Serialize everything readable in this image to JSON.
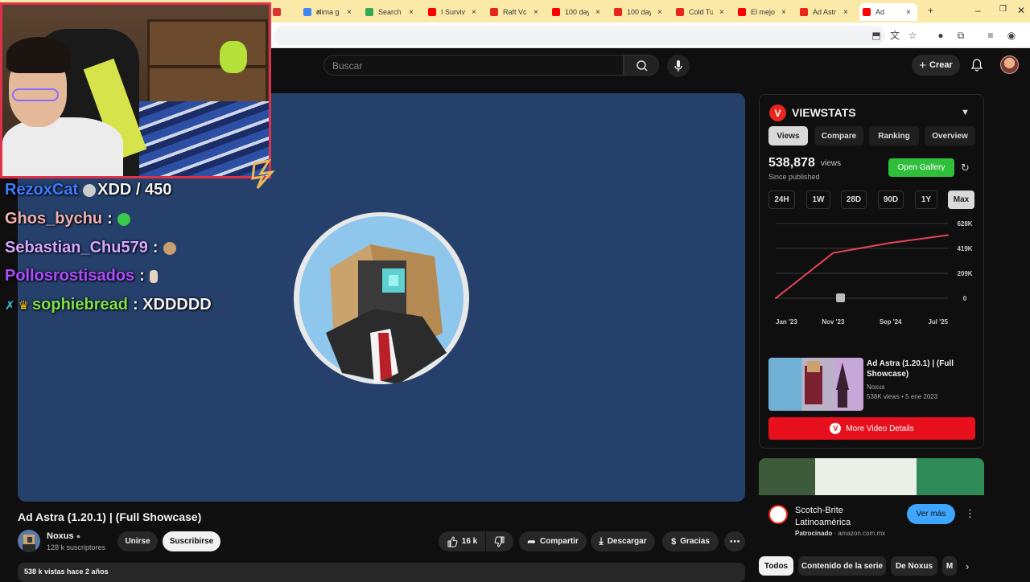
{
  "browser": {
    "tabs": [
      {
        "label": "",
        "icon": "unknown-favicon",
        "color": "#d33"
      },
      {
        "label": "clima g",
        "icon": "google-icon",
        "color": "#4285f4"
      },
      {
        "label": "Search",
        "icon": "search-extension-icon",
        "color": "#34a853"
      },
      {
        "label": "I Surviv",
        "icon": "youtube-icon",
        "color": "#ff0000"
      },
      {
        "label": "Raft Vc",
        "icon": "viewstats-icon",
        "color": "#e8261c"
      },
      {
        "label": "100 day",
        "icon": "youtube-icon",
        "color": "#ff0000"
      },
      {
        "label": "100 day",
        "icon": "viewstats-icon",
        "color": "#e8261c"
      },
      {
        "label": "Cold Tu",
        "icon": "viewstats-icon",
        "color": "#e8261c"
      },
      {
        "label": "El mejo",
        "icon": "youtube-icon",
        "color": "#ff0000"
      },
      {
        "label": "Ad Astr",
        "icon": "viewstats-icon",
        "color": "#e8261c"
      },
      {
        "label": "Ad",
        "icon": "youtube-icon",
        "color": "#ff0000"
      }
    ],
    "new_tab": "+",
    "minimize": "–",
    "maximize": "❐",
    "close": "✕"
  },
  "header": {
    "search_placeholder": "Buscar",
    "create_label": "Crear"
  },
  "chat": [
    {
      "user": "RezoxCat",
      "message": "XDD / 450",
      "color": "#3d7bff"
    },
    {
      "user": "Ghos_bychu",
      "message": ":",
      "color": "#f0b0b0"
    },
    {
      "user": "Sebastian_Chu579",
      "message": ":",
      "color": "#d7a8ff"
    },
    {
      "user": "Pollosrostisados",
      "message": ":",
      "color": "#b04cff"
    },
    {
      "user": "sophiebread",
      "message": ": XDDDDD",
      "color": "#7ee04a"
    }
  ],
  "video": {
    "title": "Ad Astra (1.20.1) | (Full Showcase)",
    "channel": "Noxus",
    "subscribers": "128 k suscriptores",
    "join_label": "Unirse",
    "subscribe_label": "Suscribirse",
    "likes": "16 k",
    "share_label": "Compartir",
    "download_label": "Descargar",
    "thanks_label": "Gracias",
    "description_meta": "538 k vistas  hace 2 años"
  },
  "viewstats": {
    "brand": "VIEWSTATS",
    "tabs": [
      "Views",
      "Compare",
      "Ranking",
      "Overview"
    ],
    "selected_tab": "Views",
    "count": "538,878",
    "count_unit": "views",
    "since": "Since published",
    "gallery_label": "Open Gallery",
    "ranges": [
      "24H",
      "1W",
      "28D",
      "90D",
      "1Y",
      "Max"
    ],
    "selected_range": "Max",
    "video_title": "Ad Astra (1.20.1) | (Full Showcase)",
    "video_channel": "Noxus",
    "video_meta": "538K views • 5 ene 2023",
    "more_label": "More Video Details",
    "accent": "#e8261c"
  },
  "chart_data": {
    "type": "line",
    "x": [
      "Jan '23",
      "Nov '23",
      "Sep '24",
      "Jul '25"
    ],
    "xlabels": [
      "Jan '23",
      "Nov '23",
      "Sep '24",
      "Jul '25"
    ],
    "yticks": [
      "628K",
      "419K",
      "209K",
      "0"
    ],
    "ylim": [
      0,
      628000
    ],
    "series": [
      {
        "values": [
          0,
          380000,
          465000,
          530000
        ]
      }
    ],
    "color": "#e8445a",
    "grid": true
  },
  "ad": {
    "title": "Scotch-Brite Latinoamérica",
    "sponsored": "Patrocinado",
    "domain": "amazon.com.mx",
    "cta": "Ver más"
  },
  "chips": [
    "Todos",
    "Contenido de la serie",
    "De Noxus",
    "M"
  ]
}
